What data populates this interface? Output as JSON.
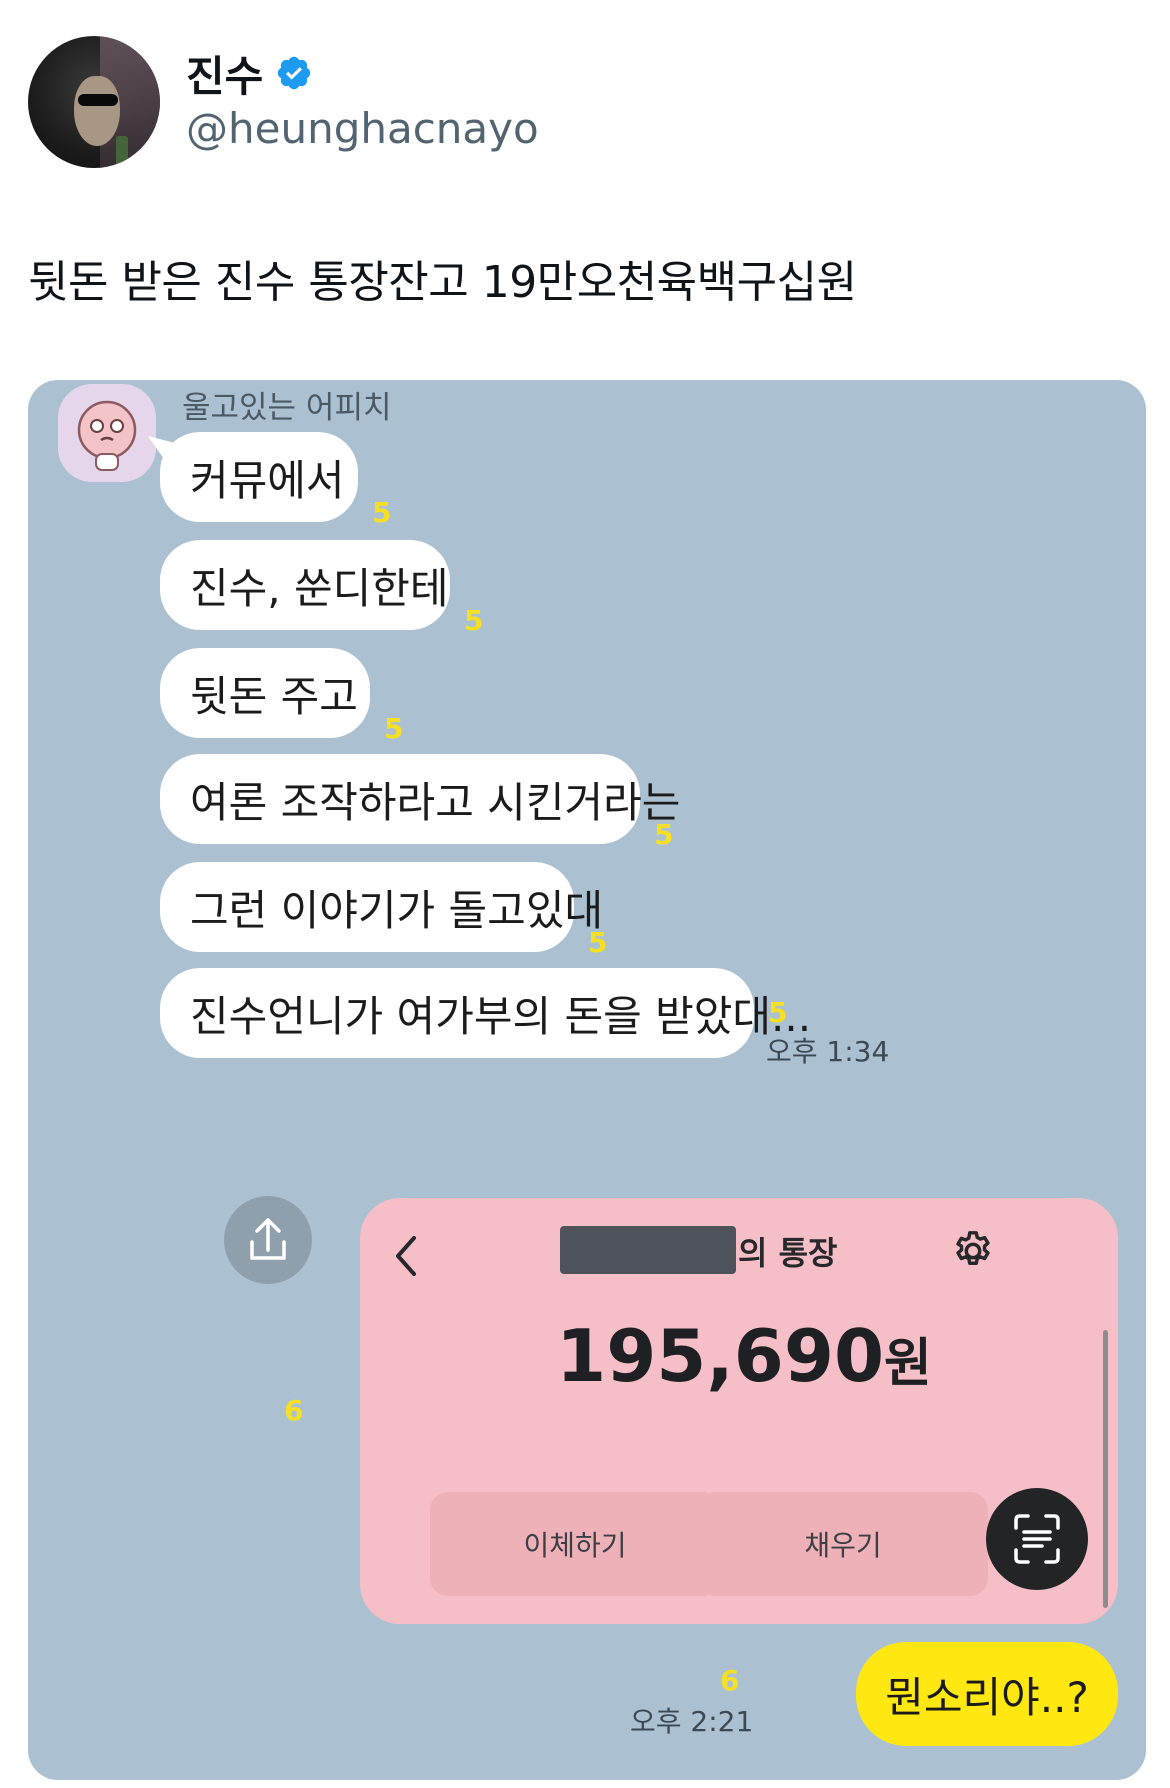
{
  "tweet": {
    "author_name": "진수",
    "handle": "@heunghacnayo",
    "text": "뒷돈 받은 진수 통장잔고 19만오천육백구십원"
  },
  "chat": {
    "sender_name": "울고있는 어피치",
    "messages": [
      {
        "text": "커뮤에서",
        "unread": "5"
      },
      {
        "text": "진수, 쑨디한테",
        "unread": "5"
      },
      {
        "text": "뒷돈 주고",
        "unread": "5"
      },
      {
        "text": "여론 조작하라고 시킨거라는",
        "unread": "5"
      },
      {
        "text": "그런 이야기가 돌고있대",
        "unread": "5"
      },
      {
        "text": "진수언니가 여가부의 돈을 받았대...",
        "unread": "5"
      }
    ],
    "received_time": "오후 1:34",
    "bank_card": {
      "title_suffix": "의 통장",
      "balance_number": "195,690",
      "balance_unit": "원",
      "transfer_label": "이체하기",
      "fill_label": "채우기",
      "unread": "6"
    },
    "reply": {
      "text": "뭔소리야..?",
      "unread": "6",
      "time": "오후 2:21"
    }
  },
  "icons": [
    "verified-badge-icon",
    "back-chevron-icon",
    "gear-icon",
    "share-icon",
    "scan-text-icon"
  ],
  "colors": {
    "chat_background": "#abc1d1",
    "incoming_bubble": "#ffffff",
    "outgoing_bubble": "#ffe812",
    "unread_count": "#f5e025",
    "bank_card": "#f6bec6",
    "verified": "#1d9bf0",
    "handle_text": "#536471"
  }
}
